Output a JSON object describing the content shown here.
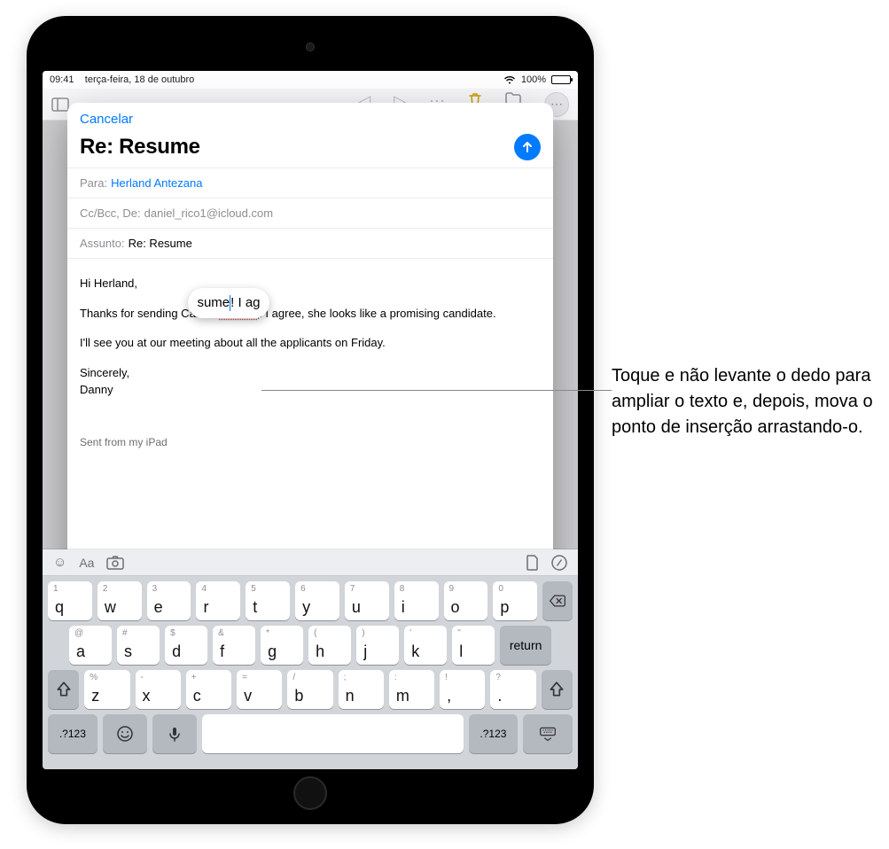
{
  "statusbar": {
    "time": "09:41",
    "date": "terça-feira, 18 de outubro",
    "battery_pct": "100%"
  },
  "compose": {
    "cancel": "Cancelar",
    "title": "Re: Resume",
    "to_label": "Para:",
    "to_value": "Herland Antezana",
    "cc_label": "Cc/Bcc, De:",
    "cc_value": "daniel_rico1@icloud.com",
    "subject_label": "Assunto:",
    "subject_value": "Re: Resume",
    "body_hi": "Hi Herland,",
    "body_p1_a": "Thanks for sending Carol's ",
    "body_p1_word": "résume",
    "body_p1_b": "! I agree, she looks like a promising candidate.",
    "body_p2": "I'll see you at our meeting about all the applicants on Friday.",
    "body_sign1": "Sincerely,",
    "body_sign2": "Danny",
    "signature": "Sent from my iPad",
    "loupe_a": "sume",
    "loupe_b": "! I ag"
  },
  "keyboard": {
    "return": "return",
    "numkey": ".?123",
    "row1": [
      {
        "main": "q",
        "alt": "1"
      },
      {
        "main": "w",
        "alt": "2"
      },
      {
        "main": "e",
        "alt": "3"
      },
      {
        "main": "r",
        "alt": "4"
      },
      {
        "main": "t",
        "alt": "5"
      },
      {
        "main": "y",
        "alt": "6"
      },
      {
        "main": "u",
        "alt": "7"
      },
      {
        "main": "i",
        "alt": "8"
      },
      {
        "main": "o",
        "alt": "9"
      },
      {
        "main": "p",
        "alt": "0"
      }
    ],
    "row2": [
      {
        "main": "a",
        "alt": "@"
      },
      {
        "main": "s",
        "alt": "#"
      },
      {
        "main": "d",
        "alt": "$"
      },
      {
        "main": "f",
        "alt": "&"
      },
      {
        "main": "g",
        "alt": "*"
      },
      {
        "main": "h",
        "alt": "("
      },
      {
        "main": "j",
        "alt": ")"
      },
      {
        "main": "k",
        "alt": "'"
      },
      {
        "main": "l",
        "alt": "\""
      }
    ],
    "row3": [
      {
        "main": "z",
        "alt": "%"
      },
      {
        "main": "x",
        "alt": "-"
      },
      {
        "main": "c",
        "alt": "+"
      },
      {
        "main": "v",
        "alt": "="
      },
      {
        "main": "b",
        "alt": "/"
      },
      {
        "main": "n",
        "alt": ";"
      },
      {
        "main": "m",
        "alt": ":"
      },
      {
        "main": ",",
        "alt": "!"
      },
      {
        "main": ".",
        "alt": "?"
      }
    ]
  },
  "callout": "Toque e não levante o dedo para ampliar o texto e, depois, mova o ponto de inserção arrastando-o."
}
